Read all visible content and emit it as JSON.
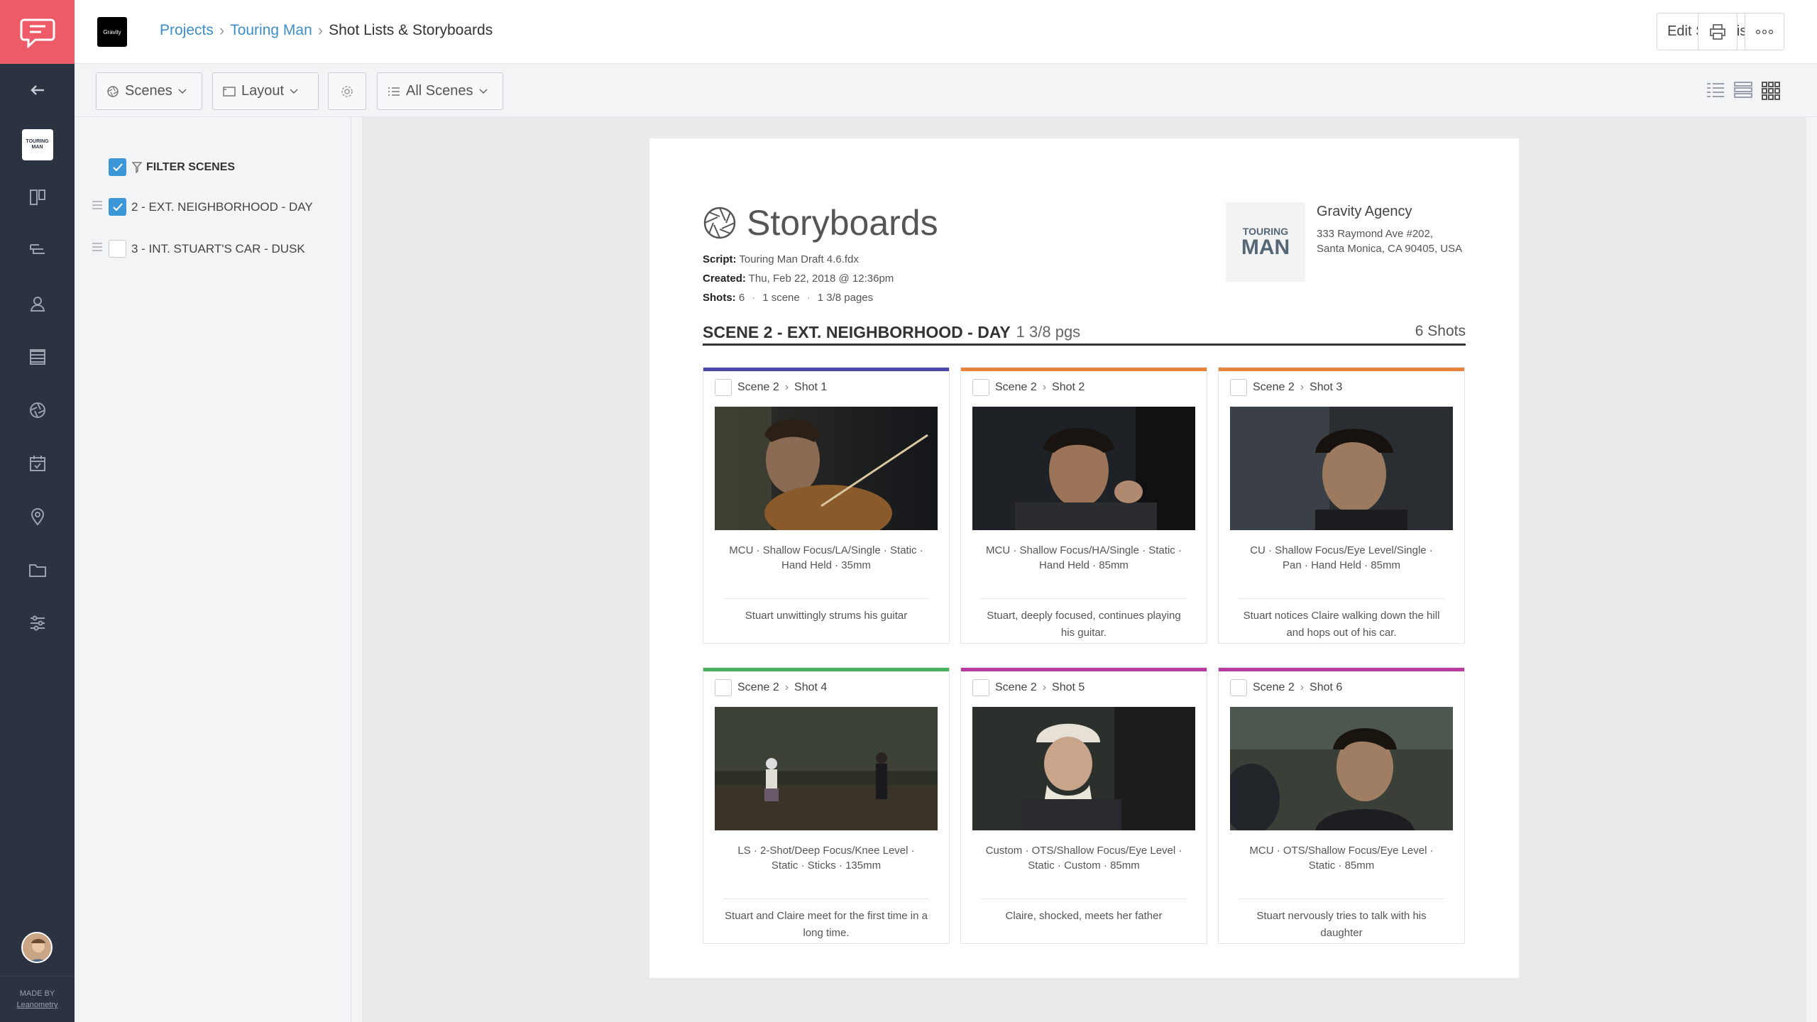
{
  "app": {
    "brand_color": "#ec5b67",
    "accent": "#3c8ec9"
  },
  "rail": {
    "project_thumb_text": "TOURING MAN",
    "made_by_line1": "MADE BY",
    "made_by_line2": "Leanometry",
    "icons": [
      "back-arrow-icon",
      "project-icon",
      "board-icon",
      "shotlist-icon",
      "cast-icon",
      "stripboard-icon",
      "storyboard-icon",
      "calendar-icon",
      "location-icon",
      "folder-icon",
      "settings-icon"
    ]
  },
  "header": {
    "agency_logo_text": "Gravity",
    "breadcrumb": {
      "projects": "Projects",
      "project": "Touring Man",
      "current": "Shot Lists & Storyboards"
    },
    "edit_button": "Edit Shot List"
  },
  "toolbar": {
    "scenes": "Scenes",
    "layout": "Layout",
    "all_scenes": "All Scenes"
  },
  "sidebar": {
    "filter_label": "FILTER SCENES",
    "scenes": [
      {
        "label": "2 - EXT. NEIGHBORHOOD - DAY",
        "checked": true
      },
      {
        "label": "3 - INT. STUART'S CAR - DUSK",
        "checked": false
      }
    ]
  },
  "document": {
    "title": "Storyboards",
    "script_label": "Script:",
    "script_value": "Touring Man Draft 4.6.fdx",
    "created_label": "Created:",
    "created_value": "Thu, Feb 22, 2018 @ 12:36pm",
    "shots_label": "Shots:",
    "shots_value": "6",
    "scene_count": "1 scene",
    "pages": "1 3/8 pages",
    "agency": {
      "logo_line1": "TOURING",
      "logo_line2": "MAN",
      "name": "Gravity Agency",
      "address1": "333 Raymond Ave #202,",
      "address2": "Santa Monica, CA 90405, USA"
    },
    "scene_heading": "SCENE 2 - EXT. NEIGHBORHOOD - DAY",
    "scene_pages": "1 3/8 pgs",
    "scene_shots": "6 Shots"
  },
  "shots": [
    {
      "scene": "Scene 2",
      "shot": "Shot 1",
      "color": "#4b49a8",
      "specs": "MCU · Shallow Focus/LA/Single · Static · Hand Held · 35mm",
      "desc": "Stuart unwittingly strums his guitar"
    },
    {
      "scene": "Scene 2",
      "shot": "Shot 2",
      "color": "#e8833a",
      "specs": "MCU · Shallow Focus/HA/Single · Static · Hand Held · 85mm",
      "desc": "Stuart, deeply focused, continues playing his guitar."
    },
    {
      "scene": "Scene 2",
      "shot": "Shot 3",
      "color": "#e8833a",
      "specs": "CU · Shallow Focus/Eye Level/Single · Pan · Hand Held · 85mm",
      "desc": "Stuart notices Claire walking down the hill and hops out of his car."
    },
    {
      "scene": "Scene 2",
      "shot": "Shot 4",
      "color": "#48b05a",
      "specs": "LS · 2-Shot/Deep Focus/Knee Level · Static · Sticks · 135mm",
      "desc": "Stuart and Claire meet for the first time in a long time."
    },
    {
      "scene": "Scene 2",
      "shot": "Shot 5",
      "color": "#b83a9e",
      "specs": "Custom · OTS/Shallow Focus/Eye Level · Static · Custom · 85mm",
      "desc": "Claire, shocked, meets her father"
    },
    {
      "scene": "Scene 2",
      "shot": "Shot 6",
      "color": "#b83a9e",
      "specs": "MCU · OTS/Shallow Focus/Eye Level · Static · 85mm",
      "desc": "Stuart nervously tries to talk with his daughter"
    }
  ]
}
